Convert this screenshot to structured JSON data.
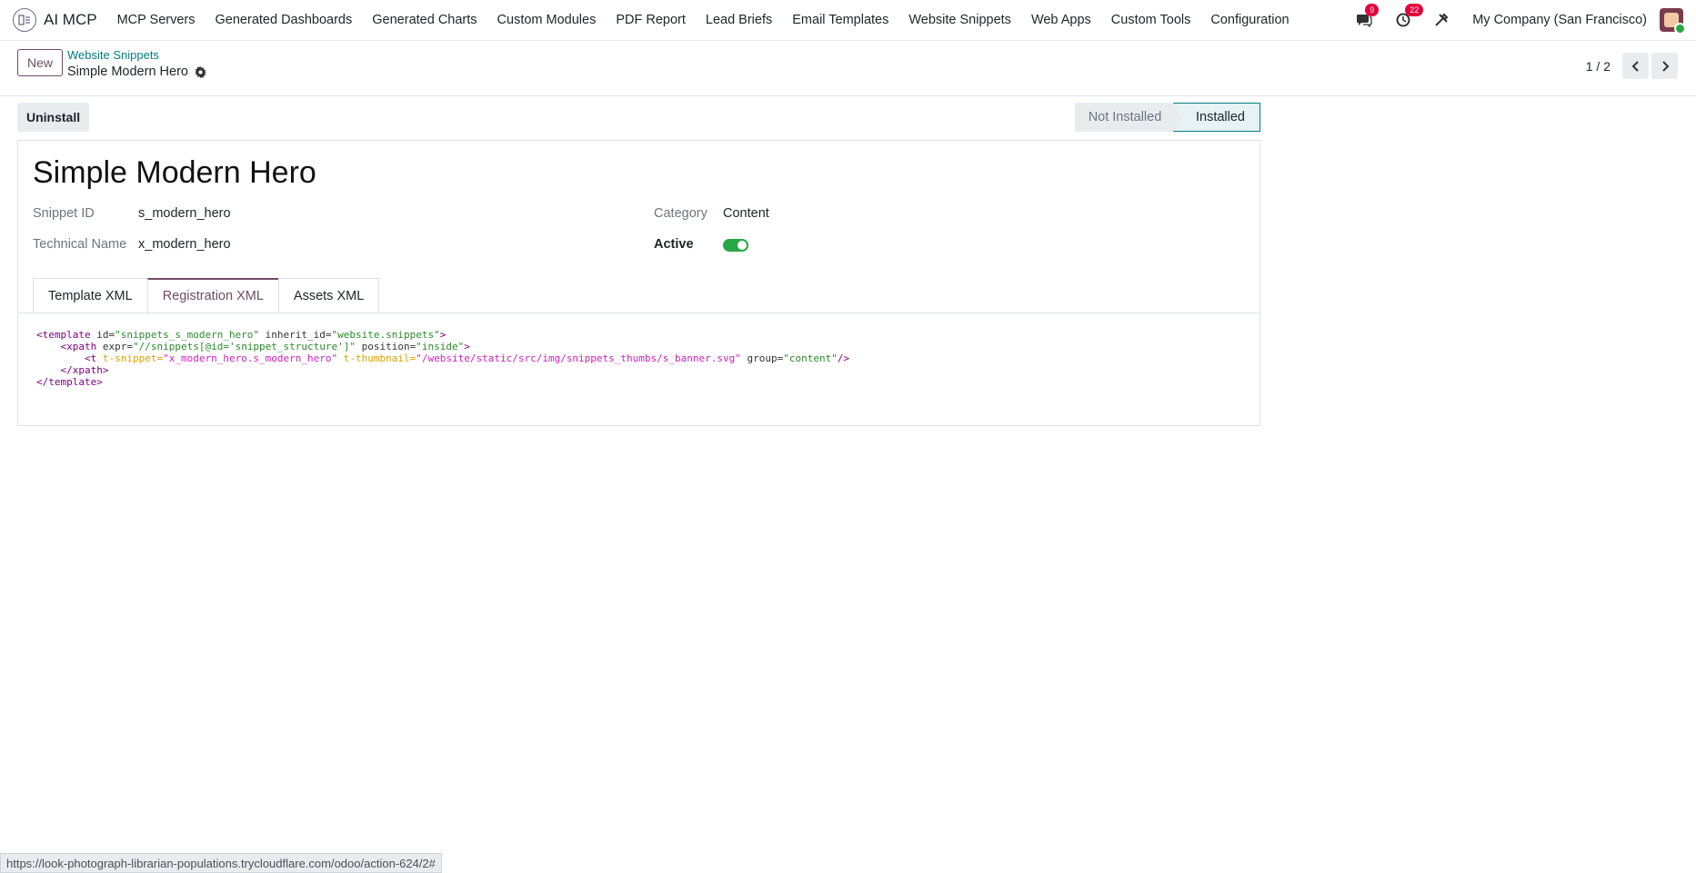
{
  "navbar": {
    "app_name": "AI MCP",
    "menu": [
      "MCP Servers",
      "Generated Dashboards",
      "Generated Charts",
      "Custom Modules",
      "PDF Report",
      "Lead Briefs",
      "Email Templates",
      "Website Snippets",
      "Web Apps",
      "Custom Tools",
      "Configuration"
    ],
    "messages_count": "9",
    "activities_count": "22",
    "company": "My Company (San Francisco)"
  },
  "control": {
    "new_label": "New",
    "breadcrumb_parent": "Website Snippets",
    "breadcrumb_current": "Simple Modern Hero",
    "pager": "1 / 2"
  },
  "statusbar": {
    "uninstall_label": "Uninstall",
    "stages": [
      "Not Installed",
      "Installed"
    ],
    "current_stage": "Installed"
  },
  "form": {
    "title": "Simple Modern Hero",
    "snippet_id_label": "Snippet ID",
    "snippet_id": "s_modern_hero",
    "technical_name_label": "Technical Name",
    "technical_name": "x_modern_hero",
    "category_label": "Category",
    "category": "Content",
    "active_label": "Active",
    "active": true,
    "tabs": [
      "Template XML",
      "Registration XML",
      "Assets XML"
    ],
    "active_tab": "Registration XML"
  },
  "code": {
    "l1_a": "<template",
    "l1_b": " id=",
    "l1_c": "\"snippets_s_modern_hero\"",
    "l1_d": " inherit_id=",
    "l1_e": "\"website.snippets\"",
    "l1_f": ">",
    "l2_a": "    <xpath",
    "l2_b": " expr=",
    "l2_c": "\"//snippets[@id='snippet_structure']\"",
    "l2_d": " position=",
    "l2_e": "\"inside\"",
    "l2_f": ">",
    "l3_a": "        <t",
    "l3_b": " t-snippet=",
    "l3_c": "\"x_modern_hero.s_modern_hero\"",
    "l3_d": " t-thumbnail=",
    "l3_e": "\"/website/static/src/img/snippets_thumbs/s_banner.svg\"",
    "l3_f": " group=",
    "l3_g": "\"content\"",
    "l3_h": "/>",
    "l4": "    </xpath>",
    "l5": "</template>"
  },
  "browser_status_url": "https://look-photograph-librarian-populations.trycloudflare.com/odoo/action-624/2#"
}
